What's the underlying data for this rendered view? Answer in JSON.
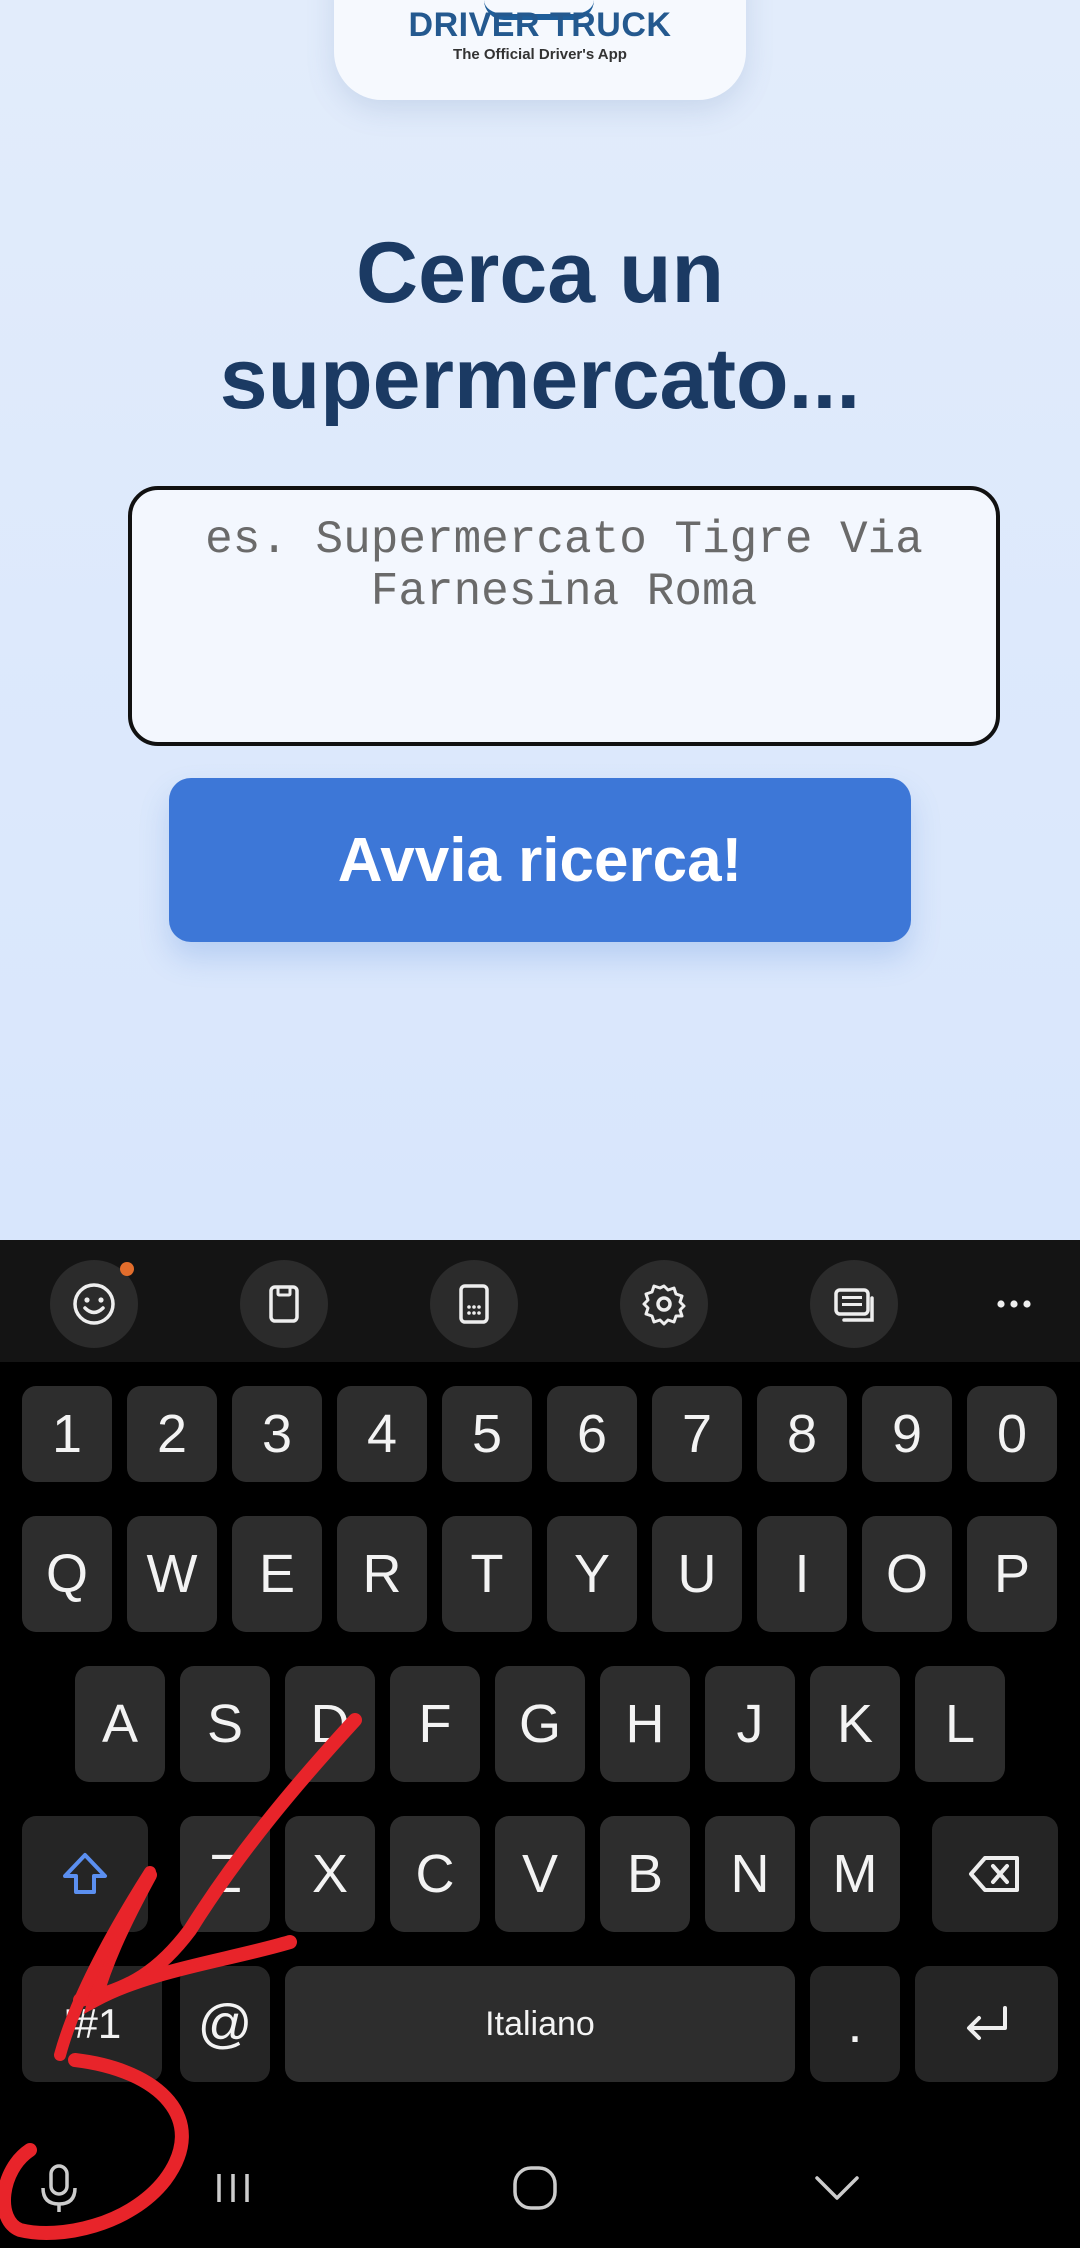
{
  "logo": {
    "title": "DRIVER TRUCK",
    "subtitle": "The Official Driver's App"
  },
  "main": {
    "heading_line1": "Cerca un",
    "heading_line2": "supermercato...",
    "search_placeholder": "es. Supermercato Tigre Via Farnesina Roma",
    "search_button": "Avvia ricerca!"
  },
  "keyboard": {
    "toolbar_icons": [
      "emoji-icon",
      "clipboard-icon",
      "keypad-icon",
      "settings-icon",
      "keyboard-mode-icon",
      "more-icon"
    ],
    "number_row": [
      "1",
      "2",
      "3",
      "4",
      "5",
      "6",
      "7",
      "8",
      "9",
      "0"
    ],
    "row_q": [
      "Q",
      "W",
      "E",
      "R",
      "T",
      "Y",
      "U",
      "I",
      "O",
      "P"
    ],
    "row_a": [
      "A",
      "S",
      "D",
      "F",
      "G",
      "H",
      "J",
      "K",
      "L"
    ],
    "row_z": [
      "Z",
      "X",
      "C",
      "V",
      "B",
      "N",
      "M"
    ],
    "symbols_key": "!#1",
    "at_key": "@",
    "space_label": "Italiano",
    "period_key": "."
  },
  "colors": {
    "heading": "#1b3a63",
    "button": "#3d77d7",
    "annotation": "#e8242a",
    "shift_icon": "#5b8ff0"
  }
}
